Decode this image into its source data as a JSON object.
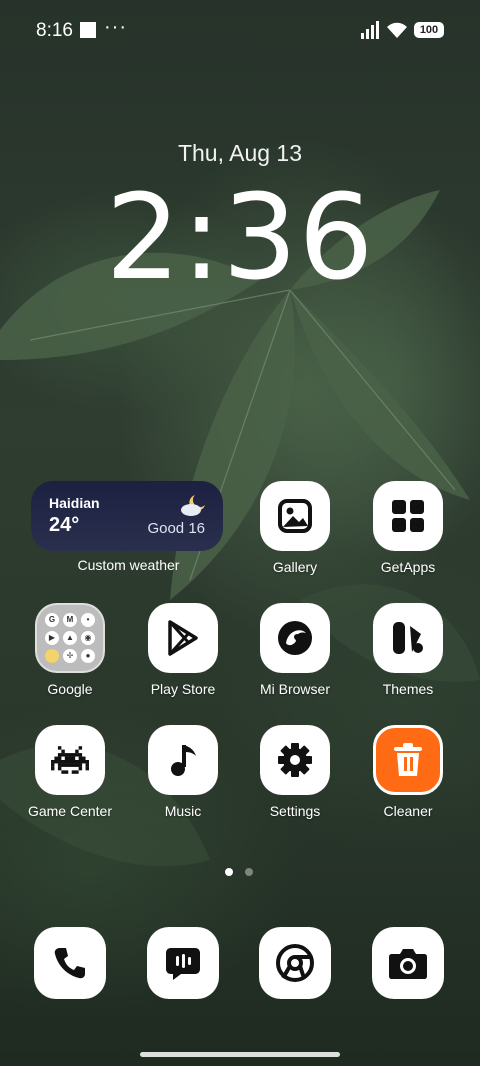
{
  "status": {
    "time": "8:16",
    "battery": "100"
  },
  "lock": {
    "date": "Thu, Aug 13",
    "time": "2:36"
  },
  "weather": {
    "city": "Haidian",
    "temp": "24°",
    "aqi": "Good 16",
    "label": "Custom weather"
  },
  "apps": {
    "gallery": "Gallery",
    "getapps": "GetApps",
    "google": "Google",
    "playstore": "Play Store",
    "browser": "Mi Browser",
    "themes": "Themes",
    "gamecenter": "Game Center",
    "music": "Music",
    "settings": "Settings",
    "cleaner": "Cleaner"
  },
  "google_folder": [
    "G",
    "M",
    "",
    "",
    "",
    "",
    "",
    "",
    ""
  ],
  "pager": {
    "pages": 2,
    "active": 1
  },
  "colors": {
    "cleaner": "#ff6a14",
    "weather_bg": "#1c2141"
  },
  "icons": {
    "dock": [
      "phone-icon",
      "messages-icon",
      "chrome-icon",
      "camera-icon"
    ]
  }
}
